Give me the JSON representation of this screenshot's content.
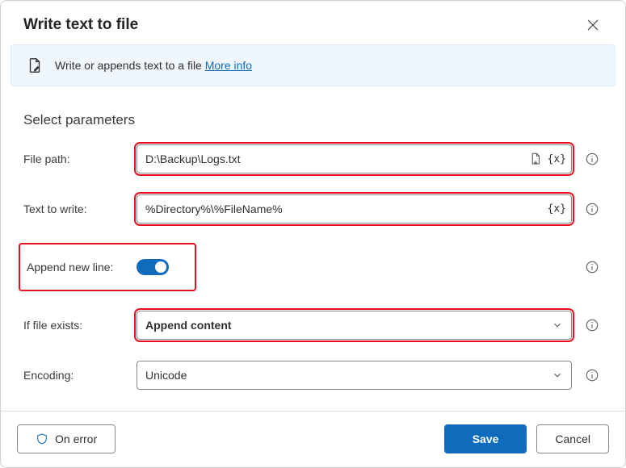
{
  "dialog": {
    "title": "Write text to file"
  },
  "banner": {
    "text": "Write or appends text to a file ",
    "link_label": "More info"
  },
  "section_heading": "Select parameters",
  "form": {
    "file_path": {
      "label": "File path:",
      "value": "D:\\Backup\\Logs.txt"
    },
    "text_to_write": {
      "label": "Text to write:",
      "value": "%Directory%\\%FileName%"
    },
    "append_new_line": {
      "label": "Append new line:",
      "on": true
    },
    "if_file_exists": {
      "label": "If file exists:",
      "value": "Append content"
    },
    "encoding": {
      "label": "Encoding:",
      "value": "Unicode"
    }
  },
  "footer": {
    "on_error": "On error",
    "save": "Save",
    "cancel": "Cancel"
  },
  "colors": {
    "accent": "#0f6cbd",
    "highlight": "#e81123"
  }
}
